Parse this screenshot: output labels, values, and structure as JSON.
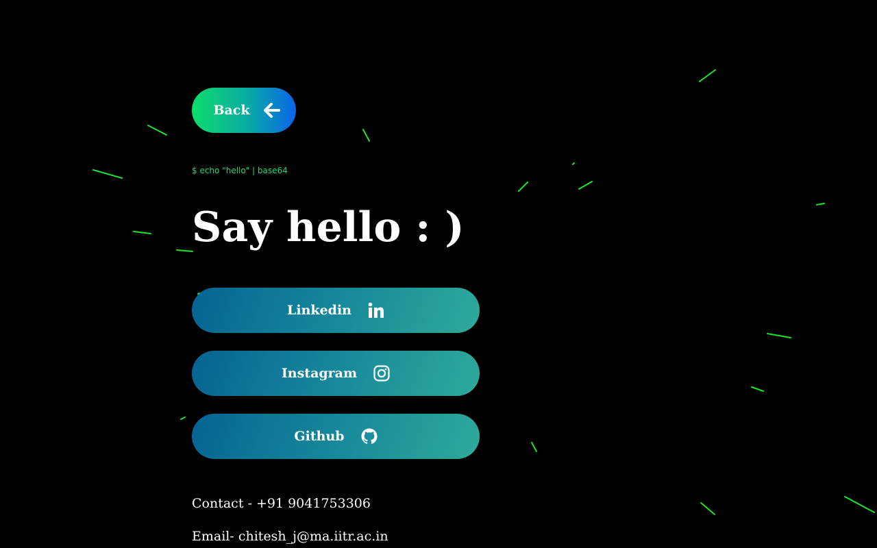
{
  "back_button": {
    "label": "Back",
    "icon": "arrow-left-icon"
  },
  "terminal_command": "$ echo \"hello\" | base64",
  "title": "Say hello : )",
  "social_links": [
    {
      "label": "Linkedin",
      "icon": "linkedin-icon"
    },
    {
      "label": "Instagram",
      "icon": "instagram-icon"
    },
    {
      "label": "Github",
      "icon": "github-icon"
    }
  ],
  "contact": {
    "phone_line": "Contact - +91 9041753306",
    "email_line": "Email- chitesh_j@ma.iitr.ac.in"
  },
  "colors": {
    "background": "#000000",
    "streak": "#19e62a",
    "terminal_text": "#22d97a",
    "back_gradient": [
      "#0ddc6b",
      "#0a64e8"
    ],
    "social_gradient": [
      "#056393",
      "#2faa9a"
    ]
  }
}
